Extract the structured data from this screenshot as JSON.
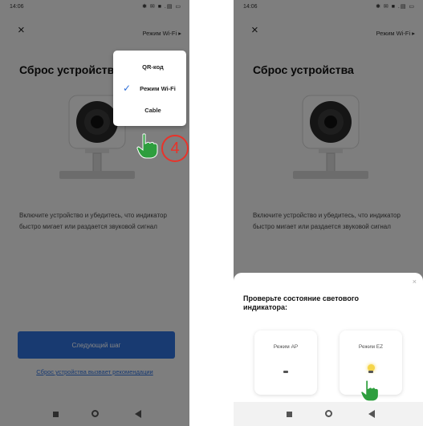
{
  "left_screen": {
    "status": {
      "time": "14:06",
      "icons": "✱ ✉ ■ .▤ ▭"
    },
    "header": {
      "close": "×",
      "mode_label": "Режим Wi-Fi ▸"
    },
    "title": "Сброс устройства",
    "description": "Включите устройство и убедитесь, что индикатор быстро мигает или раздается звуковой сигнал",
    "next_button": "Следующий шаг",
    "reset_link": "Сброс устройства вызвает рекомендации",
    "dropdown": {
      "items": [
        {
          "label": "QR-код",
          "checked": false
        },
        {
          "label": "Режим Wi-Fi",
          "checked": true
        },
        {
          "label": "Cable",
          "checked": false
        }
      ],
      "check_glyph": "✓"
    },
    "step_number": "4"
  },
  "right_screen": {
    "status": {
      "time": "14:06",
      "icons": "✱ ✉ ■ .▤ ▭"
    },
    "header": {
      "close": "×",
      "mode_label": "Режим Wi-Fi ▸"
    },
    "title": "Сброс устройства",
    "description": "Включите устройство и убедитесь, что индикатор быстро мигает или раздается звуковой сигнал",
    "sheet": {
      "close": "×",
      "title": "Проверьте состояние светового индикатора:",
      "options": [
        {
          "label": "Режим AP"
        },
        {
          "label": "Режим EZ"
        }
      ]
    }
  },
  "colors": {
    "accent": "#2f6fd8",
    "badge": "#e8332a",
    "hand": "#2e9e3e",
    "indicator": "#f5d54a"
  }
}
